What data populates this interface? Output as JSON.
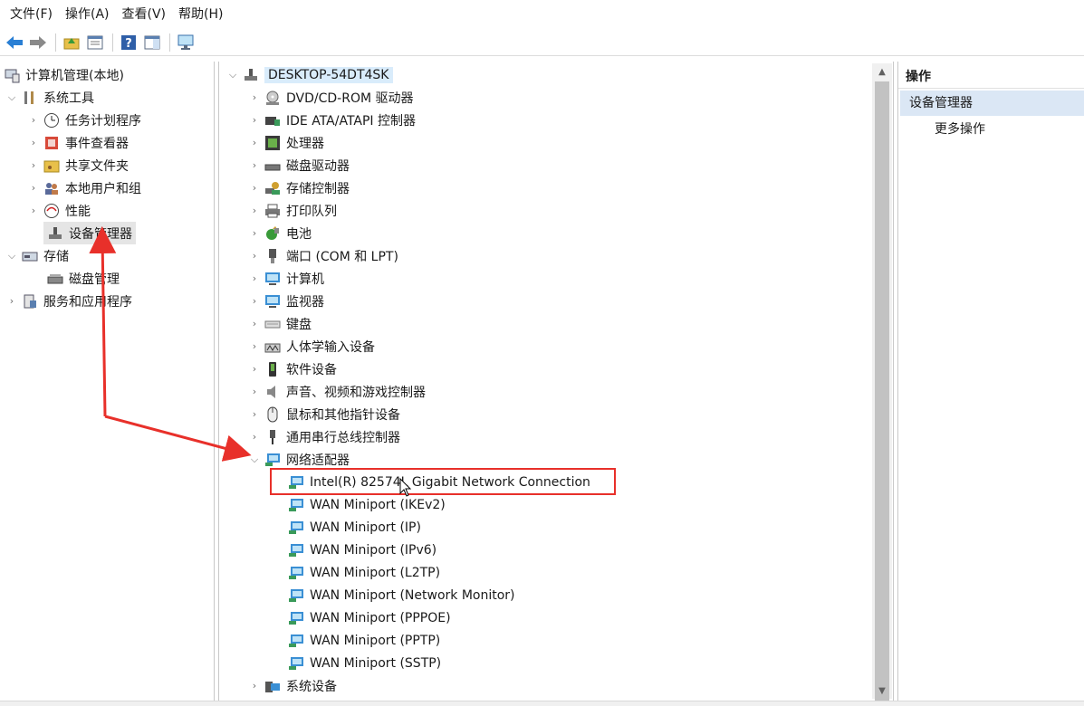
{
  "menubar": {
    "items": [
      "文件(F)",
      "操作(A)",
      "查看(V)",
      "帮助(H)"
    ]
  },
  "toolbar": {
    "buttons": [
      "back-arrow-icon",
      "forward-arrow-icon",
      "folder-up-icon",
      "properties-icon",
      "help-icon",
      "show-hide-icon",
      "monitor-icon"
    ]
  },
  "left_tree": {
    "root": "计算机管理(本地)",
    "system_tools": "系统工具",
    "task_scheduler": "任务计划程序",
    "event_viewer": "事件查看器",
    "shared_folders": "共享文件夹",
    "local_users": "本地用户和组",
    "performance": "性能",
    "device_manager": "设备管理器",
    "storage": "存储",
    "disk_management": "磁盘管理",
    "services_apps": "服务和应用程序"
  },
  "device_tree": {
    "computer": "DESKTOP-54DT4SK",
    "categories": {
      "dvd": "DVD/CD-ROM 驱动器",
      "ide": "IDE ATA/ATAPI 控制器",
      "cpu": "处理器",
      "disk": "磁盘驱动器",
      "storage_ctrl": "存储控制器",
      "print_queue": "打印队列",
      "battery": "电池",
      "ports": "端口 (COM 和 LPT)",
      "computer": "计算机",
      "monitors": "监视器",
      "keyboards": "键盘",
      "hid": "人体学输入设备",
      "software": "软件设备",
      "sound": "声音、视频和游戏控制器",
      "mice": "鼠标和其他指针设备",
      "usb": "通用串行总线控制器",
      "network": "网络适配器",
      "system": "系统设备"
    },
    "network_adapters": [
      "Intel(R) 82574L Gigabit Network Connection",
      "WAN Miniport (IKEv2)",
      "WAN Miniport (IP)",
      "WAN Miniport (IPv6)",
      "WAN Miniport (L2TP)",
      "WAN Miniport (Network Monitor)",
      "WAN Miniport (PPPOE)",
      "WAN Miniport (PPTP)",
      "WAN Miniport (SSTP)"
    ]
  },
  "actions": {
    "header": "操作",
    "section": "设备管理器",
    "more": "更多操作"
  },
  "colors": {
    "annotation_red": "#e8302a",
    "selection_gray": "#e5e5e5",
    "action_section_bg": "#dbe7f5"
  }
}
